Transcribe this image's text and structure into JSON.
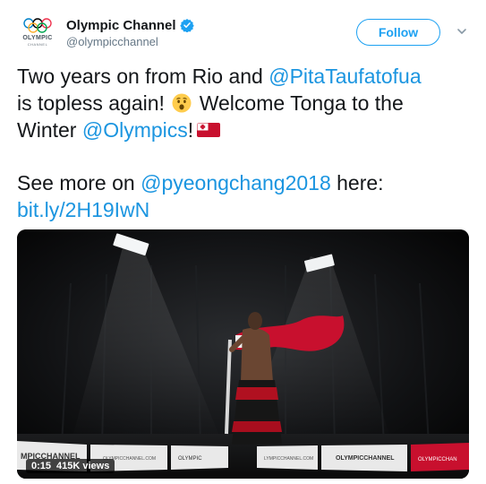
{
  "account": {
    "display_name": "Olympic Channel",
    "handle": "@olympicchannel",
    "avatar_text": "OLYMPIC",
    "avatar_subtext": "CHANNEL",
    "verified": true
  },
  "header": {
    "follow_label": "Follow"
  },
  "tweet": {
    "l1_text": "Two years on from Rio and ",
    "l1_mention": "@PitaTaufatofua",
    "l2_text": "is topless again! ",
    "l2_text_after": " Welcome Tonga to the",
    "l3_text": "Winter ",
    "l3_mention": "@Olympics",
    "l3_text_after": "!",
    "l4_text": "See more on ",
    "l4_mention": "@pyeongchang2018",
    "l4_text_after": " here:",
    "link": "bit.ly/2H19IwN",
    "emojis": [
      "hushed-face-emoji",
      "tonga-flag-emoji"
    ]
  },
  "video": {
    "duration": "0:15",
    "views": "415K views",
    "board_texts": [
      "MPICCHANNEL",
      "OLYMPICCHANNEL.COM",
      "OLYMPIC",
      "LYMPICCHANNEL.COM",
      "OLYMPICCHANNEL",
      "OLYMPICCHAN"
    ],
    "colors": {
      "flag_red": "#c8102e",
      "board_white": "#e9e9e9"
    }
  },
  "colors": {
    "link": "#1b95e0",
    "follow": "#1da1f2",
    "text": "#14171a",
    "secondary": "#657786"
  }
}
